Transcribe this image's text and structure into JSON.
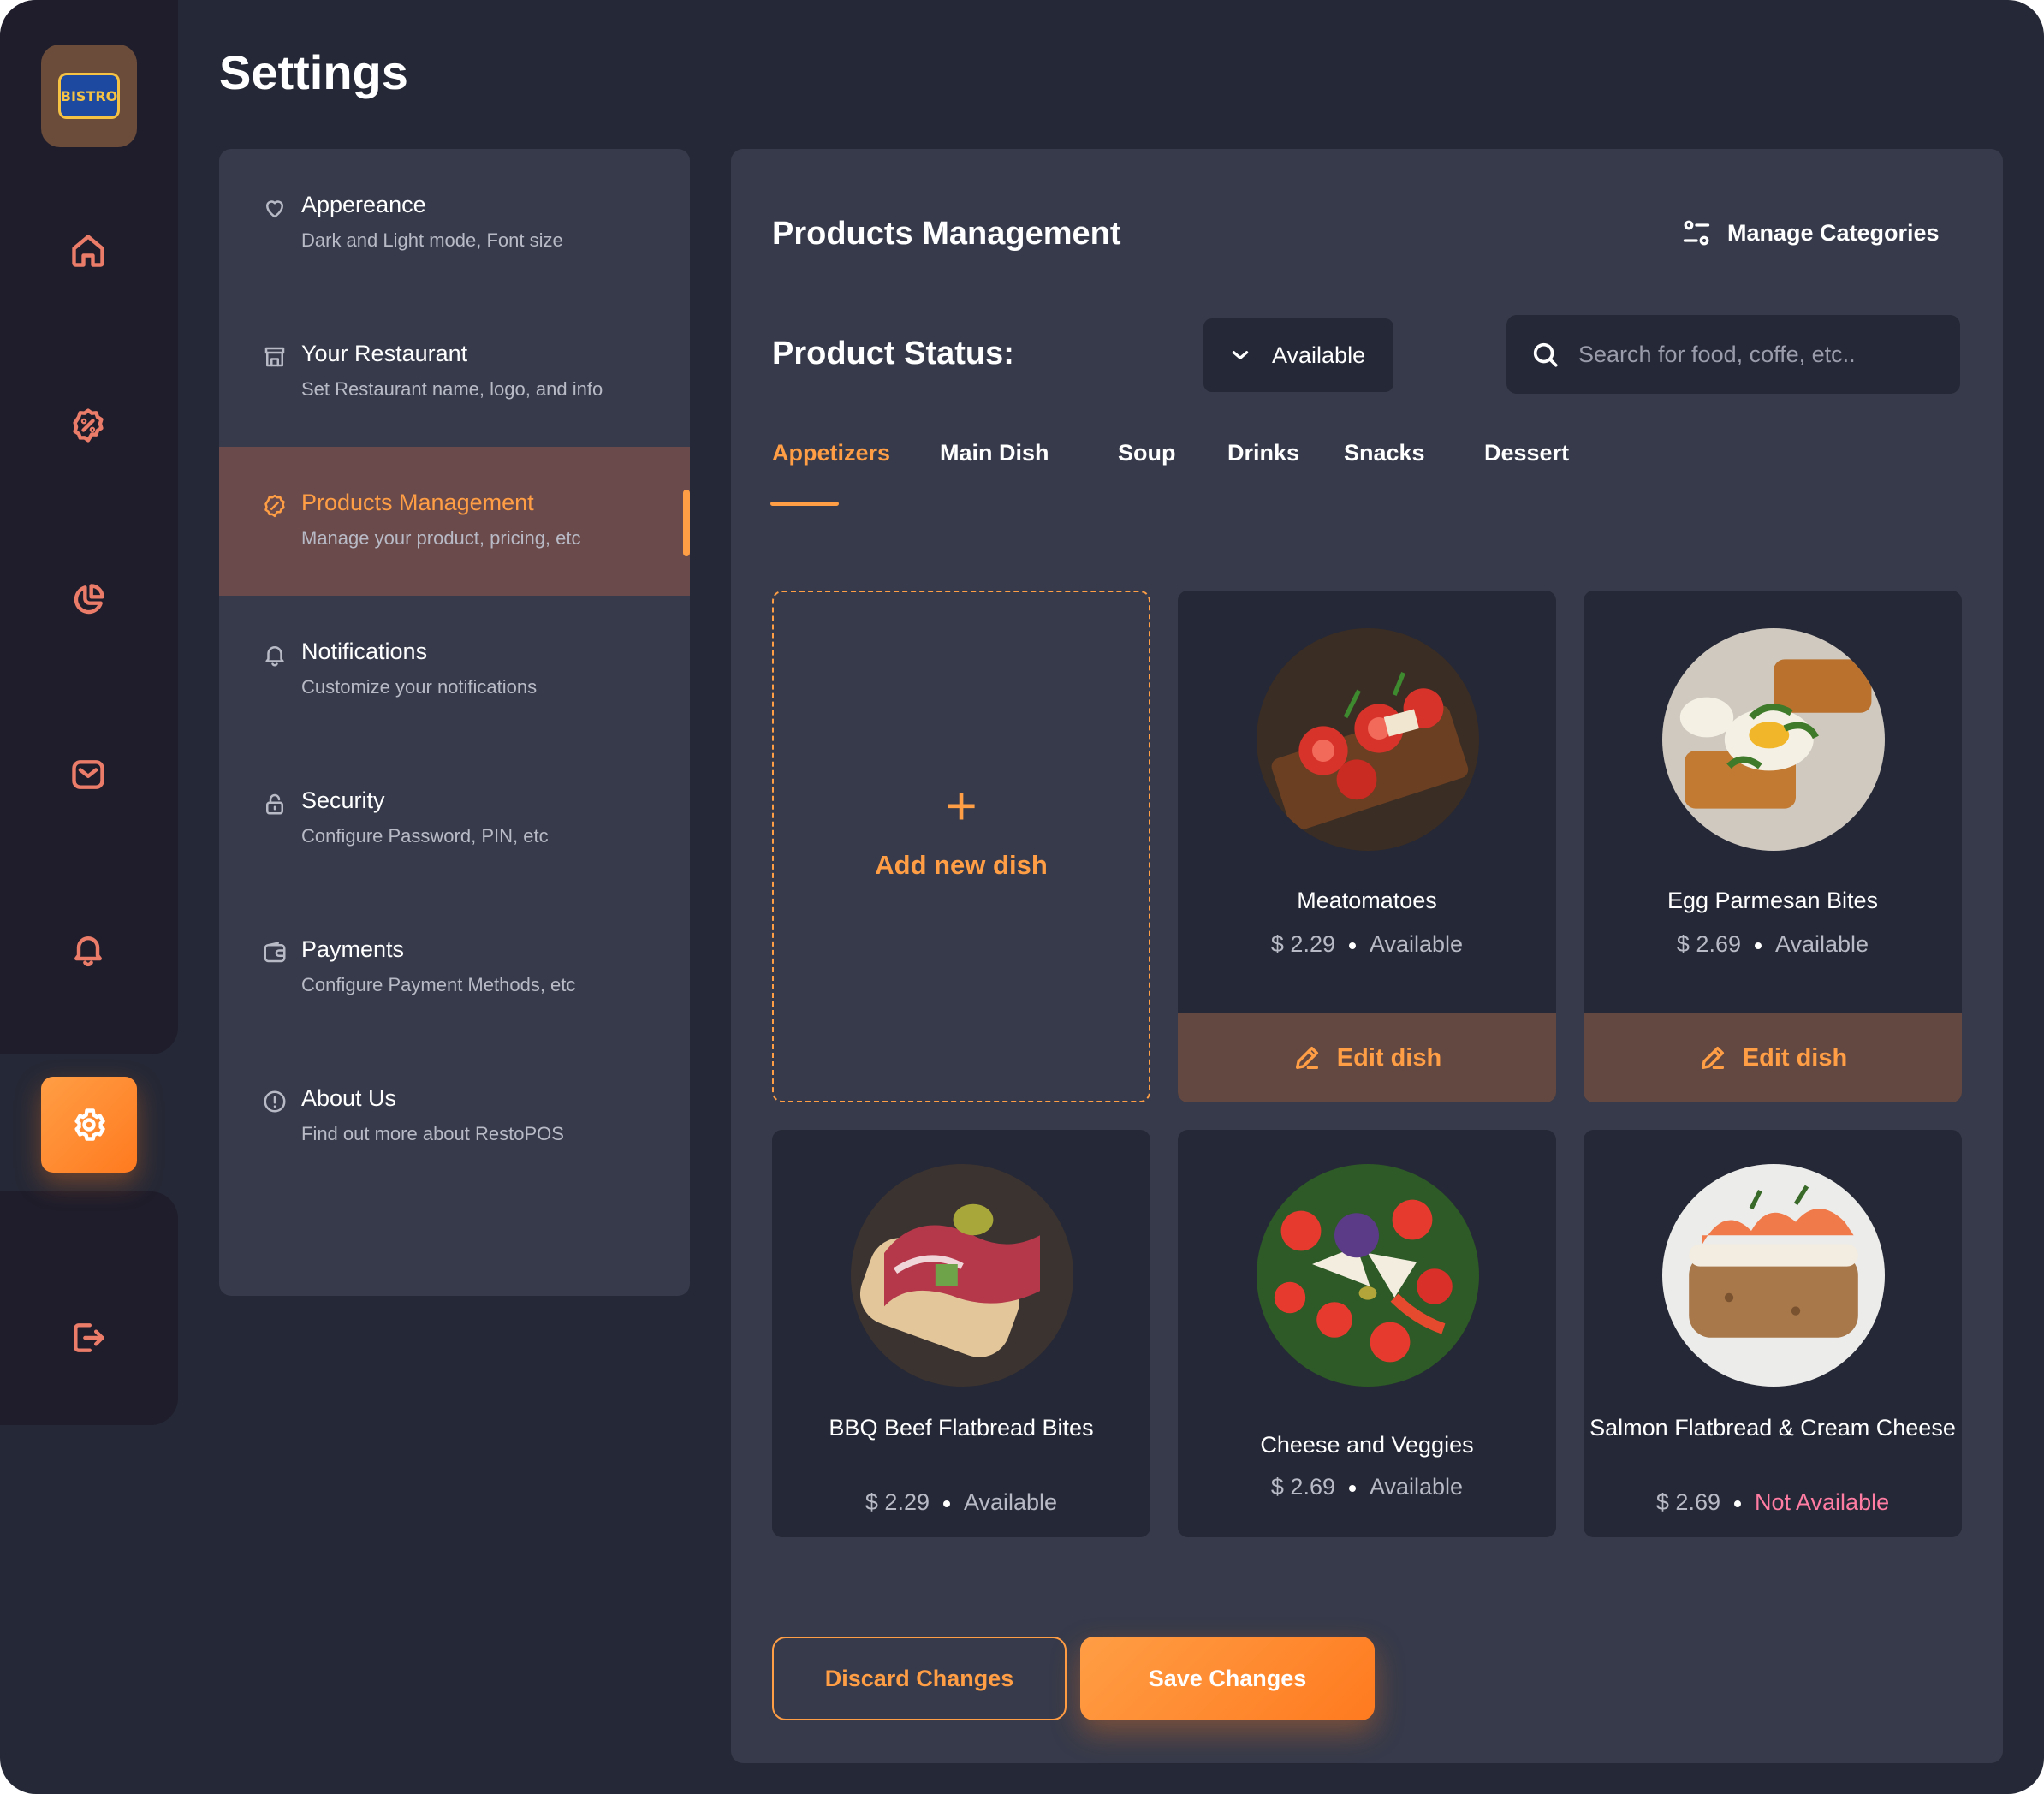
{
  "app": {
    "logo_text": "BISTRO",
    "page_title": "Settings"
  },
  "nav": {
    "items": [
      {
        "icon": "home-icon"
      },
      {
        "icon": "discount-icon"
      },
      {
        "icon": "pie-chart-icon"
      },
      {
        "icon": "mail-icon"
      },
      {
        "icon": "bell-icon"
      },
      {
        "icon": "gear-icon",
        "active": true
      },
      {
        "icon": "logout-icon"
      }
    ]
  },
  "settings_menu": {
    "items": [
      {
        "title": "Appereance",
        "subtitle": "Dark and Light mode, Font size",
        "icon": "heart-icon"
      },
      {
        "title": "Your Restaurant",
        "subtitle": "Set Restaurant name, logo, and info",
        "icon": "store-icon"
      },
      {
        "title": "Products Management",
        "subtitle": "Manage your product, pricing, etc",
        "icon": "discount-icon",
        "active": true
      },
      {
        "title": "Notifications",
        "subtitle": "Customize your notifications",
        "icon": "bell-icon"
      },
      {
        "title": "Security",
        "subtitle": "Configure Password, PIN, etc",
        "icon": "lock-icon"
      },
      {
        "title": "Payments",
        "subtitle": "Configure Payment Methods, etc",
        "icon": "wallet-icon"
      },
      {
        "title": "About Us",
        "subtitle": "Find out more about RestoPOS",
        "icon": "info-icon"
      }
    ]
  },
  "main": {
    "title": "Products Management",
    "manage_categories": "Manage Categories",
    "status_label": "Product Status:",
    "status_value": "Available",
    "search_placeholder": "Search for food, coffe, etc..",
    "tabs": [
      "Appetizers",
      "Main Dish",
      "Soup",
      "Drinks",
      "Snacks",
      "Dessert"
    ],
    "active_tab": "Appetizers",
    "add_new_label": "Add new dish",
    "edit_label": "Edit dish",
    "dishes": [
      {
        "name": "Meatomatoes",
        "price": "$ 2.29",
        "status": "Available"
      },
      {
        "name": "Egg Parmesan Bites",
        "price": "$ 2.69",
        "status": "Available"
      },
      {
        "name": "BBQ Beef Flatbread Bites",
        "price": "$ 2.29",
        "status": "Available"
      },
      {
        "name": "Cheese and Veggies",
        "price": "$ 2.69",
        "status": "Available"
      },
      {
        "name": "Salmon Flatbread & Cream Cheese",
        "price": "$ 2.69",
        "status": "Not Available"
      }
    ],
    "discard_label": "Discard Changes",
    "save_label": "Save Changes"
  },
  "colors": {
    "accent": "#ff9e45",
    "background": "#252836",
    "panel": "#363a4a",
    "not_available": "#ff7ca3"
  }
}
